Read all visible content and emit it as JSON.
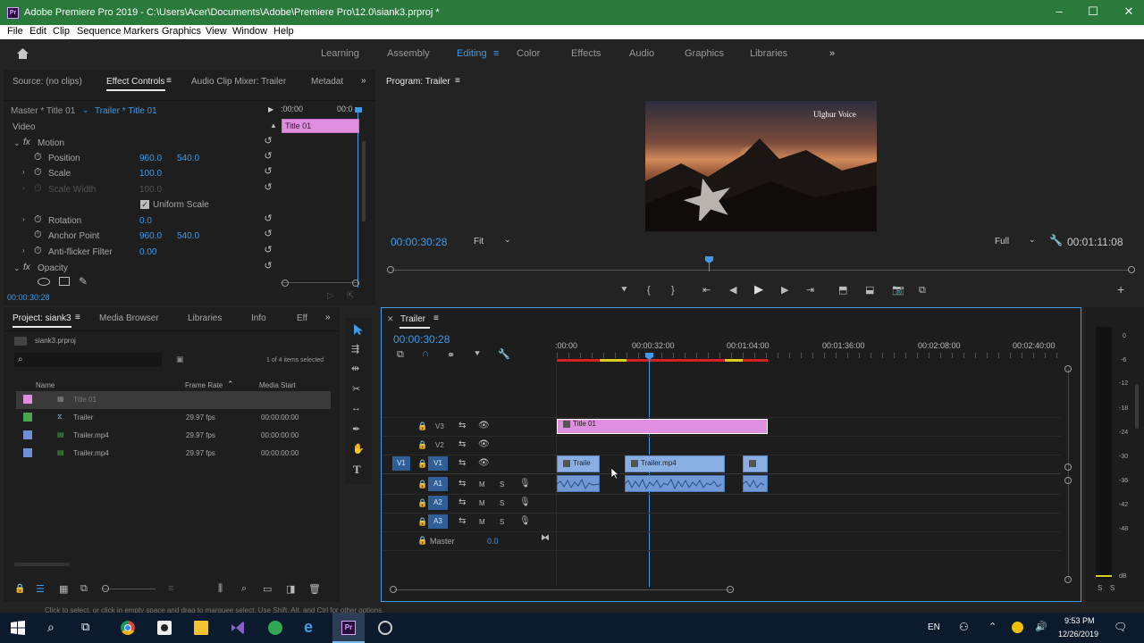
{
  "titlebar": {
    "title": "Adobe Premiere Pro 2019 - C:\\Users\\Acer\\Documents\\Adobe\\Premiere Pro\\12.0\\siank3.prproj *",
    "app_badge": "Pr"
  },
  "menu": [
    "File",
    "Edit",
    "Clip",
    "Sequence",
    "Markers",
    "Graphics",
    "View",
    "Window",
    "Help"
  ],
  "workspaces": [
    "Learning",
    "Assembly",
    "Editing",
    "Color",
    "Effects",
    "Audio",
    "Graphics",
    "Libraries"
  ],
  "active_workspace": "Editing",
  "top_left_panel": {
    "tabs": [
      "Source: (no clips)",
      "Effect Controls",
      "Audio Clip Mixer: Trailer",
      "Metadat"
    ],
    "master": "Master * Title 01",
    "sequence": "Trailer * Title 01",
    "ruler_start": ":00:00",
    "ruler_end": "00:0",
    "clip_label": "Title 01",
    "section": "Video",
    "effects": [
      {
        "name": "Motion",
        "type": "group"
      },
      {
        "name": "Position",
        "v1": "960.0",
        "v2": "540.0"
      },
      {
        "name": "Scale",
        "v1": "100.0"
      },
      {
        "name": "Scale Width",
        "v1": "100.0",
        "disabled": true
      },
      {
        "name": "Uniform Scale",
        "type": "checkbox"
      },
      {
        "name": "Rotation",
        "v1": "0.0"
      },
      {
        "name": "Anchor Point",
        "v1": "960.0",
        "v2": "540.0"
      },
      {
        "name": "Anti-flicker Filter",
        "v1": "0.00"
      },
      {
        "name": "Opacity",
        "type": "group"
      }
    ],
    "timecode": "00:00:30:28"
  },
  "program": {
    "title": "Program: Trailer",
    "watermark": "Ulghur Voice",
    "timecode": "00:00:30:28",
    "fit": "Fit",
    "quality": "Full",
    "duration": "00:01:11:08"
  },
  "project": {
    "tabs": [
      "Project: siank3",
      "Media Browser",
      "Libraries",
      "Info",
      "Eff"
    ],
    "file": "siank3.prproj",
    "items_selected": "1 of 4 items selected",
    "columns": [
      "Name",
      "Frame Rate",
      "Media Start"
    ],
    "rows": [
      {
        "name": "Title 01",
        "fps": "",
        "start": "",
        "color": "#e08ee0"
      },
      {
        "name": "Trailer",
        "fps": "29.97 fps",
        "start": "00:00:00:00",
        "color": "#4aa64a"
      },
      {
        "name": "Trailer.mp4",
        "fps": "29.97 fps",
        "start": "00:00:00:00",
        "color": "#6e8fd4"
      },
      {
        "name": "Trailer.mp4",
        "fps": "29.97 fps",
        "start": "00:00:00:00",
        "color": "#6e8fd4"
      }
    ]
  },
  "timeline": {
    "title": "Trailer",
    "timecode": "00:00:30:28",
    "ruler": [
      ":00:00",
      "00:00:32:00",
      "00:01:04:00",
      "00:01:36:00",
      "00:02:08:00",
      "00:02:40:00"
    ],
    "tracks": [
      "V3",
      "V2",
      "V1",
      "A1",
      "A2",
      "A3"
    ],
    "source_patch": "V1",
    "master_label": "Master",
    "master_value": "0.0",
    "clips": {
      "title": "Title 01",
      "trailer_a": "Traile",
      "trailer_b": "Trailer.mp4"
    }
  },
  "meters": {
    "ticks": [
      "0",
      "-6",
      "-12",
      "-18",
      "-24",
      "-30",
      "-36",
      "-42",
      "-48",
      "dB"
    ],
    "solo": [
      "S",
      "S"
    ]
  },
  "statusbar": {
    "hint": "Click to select, or click in empty space and drag to marquee select. Use Shift, Alt, and Ctrl for other options."
  },
  "taskbar": {
    "lang": "EN",
    "time": "9:53 PM",
    "date": "12/26/2019"
  }
}
